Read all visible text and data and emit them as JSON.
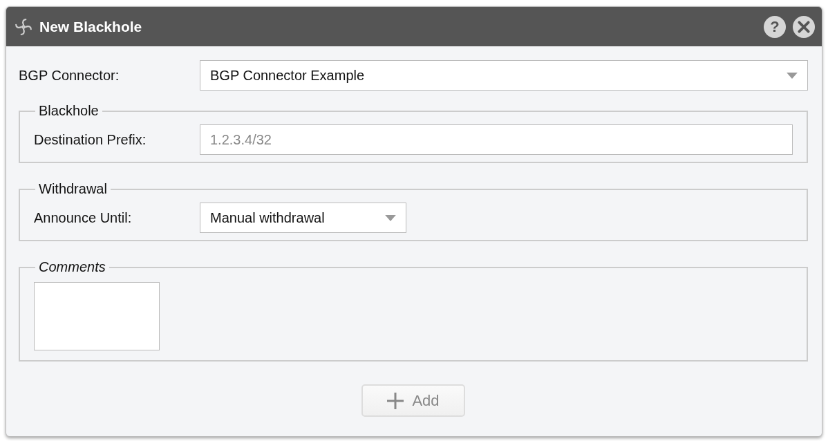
{
  "window": {
    "title": "New Blackhole",
    "help": "?"
  },
  "connector": {
    "label": "BGP Connector:",
    "value": "BGP Connector Example"
  },
  "blackhole": {
    "legend": "Blackhole",
    "label": "Destination Prefix:",
    "placeholder": "1.2.3.4/32"
  },
  "withdrawal": {
    "legend": "Withdrawal",
    "label": "Announce Until:",
    "value": "Manual withdrawal"
  },
  "comments": {
    "legend": "Comments"
  },
  "add_button": {
    "label": "Add",
    "disabled": true
  }
}
